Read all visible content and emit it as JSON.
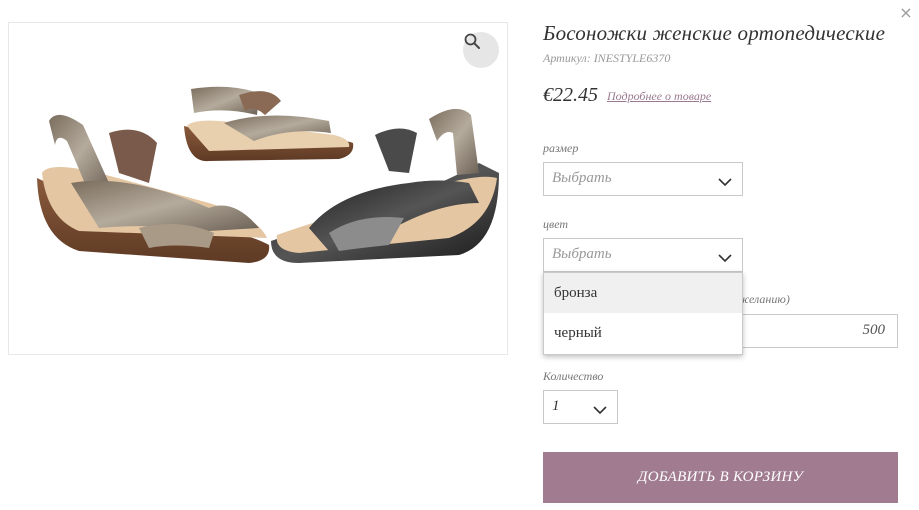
{
  "dialog": {
    "close_label": "×"
  },
  "gallery": {
    "zoom_icon": "magnifier-icon",
    "image": "product-photo-sandals"
  },
  "product": {
    "title": "Босоножки женские ортопедические",
    "sku_label": "Артикул:",
    "sku_value": "INESTYLE6370",
    "price": "€22.45",
    "details_link": "Подробнее о товаре"
  },
  "size": {
    "label": "размер",
    "placeholder": "Выбрать"
  },
  "color": {
    "label": "цвет",
    "placeholder": "Выбрать",
    "options": [
      "бронза",
      "черный"
    ],
    "highlighted": "бронза"
  },
  "amount": {
    "label_partial": "желанию)",
    "value": "500"
  },
  "quantity": {
    "label": "Количество",
    "value": "1"
  },
  "cart": {
    "button_label": "Добавить в корзину"
  },
  "colors": {
    "accent": "#a17c90",
    "link": "#9a7a8e"
  }
}
